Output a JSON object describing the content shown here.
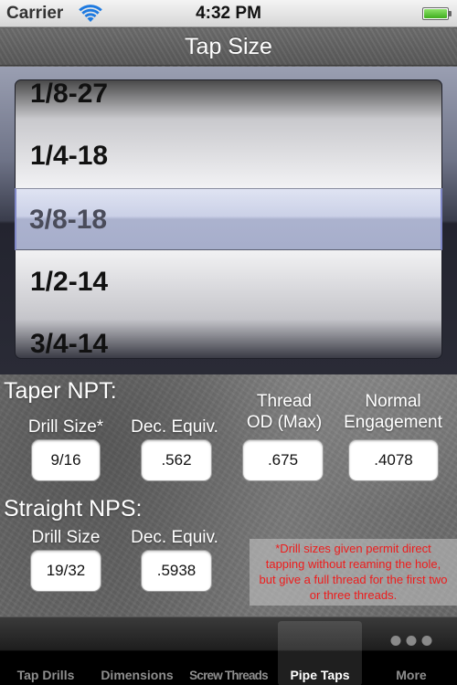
{
  "status_bar": {
    "carrier": "Carrier",
    "time": "4:32 PM",
    "wifi_icon": "wifi-icon",
    "battery_icon": "battery-icon",
    "battery_level_percent": 100
  },
  "nav_bar": {
    "title": "Tap Size"
  },
  "picker": {
    "rows": [
      "1/8-27",
      "1/4-18",
      "3/8-18",
      "1/2-14",
      "3/4-14"
    ],
    "selected": "3/8-18",
    "selection_color": "#a0a8c8"
  },
  "taper_npt": {
    "title": "Taper NPT:",
    "columns": [
      {
        "label": "Drill Size*",
        "value": "9/16"
      },
      {
        "label": "Dec. Equiv.",
        "value": ".562"
      },
      {
        "label_line1": "Thread",
        "label_line2": "OD (Max)",
        "value": ".675"
      },
      {
        "label_line1": "Normal",
        "label_line2": "Engagement",
        "value": ".4078"
      }
    ]
  },
  "straight_nps": {
    "title": "Straight NPS:",
    "columns": [
      {
        "label": "Drill Size",
        "value": "19/32"
      },
      {
        "label": "Dec. Equiv.",
        "value": ".5938"
      }
    ]
  },
  "note": {
    "lines": [
      "*Drill sizes given permit direct",
      "tapping without reaming the hole,",
      "but give a full thread for the first two",
      "or three threads."
    ],
    "color": "#ee1c1c"
  },
  "tab_bar": {
    "tabs": [
      {
        "label": "Tap Drills",
        "selected": false
      },
      {
        "label": "Dimensions",
        "selected": false
      },
      {
        "label": "Screw Threads",
        "selected": false
      },
      {
        "label": "Pipe Taps",
        "selected": true
      },
      {
        "label": "More",
        "icon": "more-dots-icon",
        "selected": false
      }
    ]
  }
}
